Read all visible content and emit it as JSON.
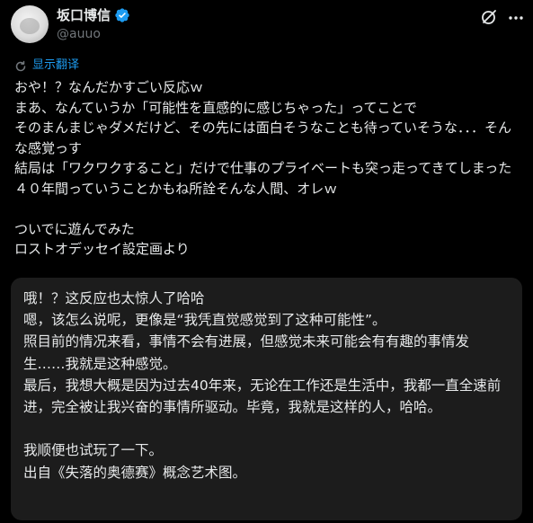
{
  "author": {
    "display_name": "坂口博信",
    "handle": "@auuo",
    "verified": true
  },
  "icons": {
    "avatar": "avatar-image",
    "verified": "verified-badge-icon",
    "grok": "grok-icon",
    "more": "more-icon",
    "translate": "translate-icon"
  },
  "colors": {
    "background": "#000000",
    "text": "#e7e9ea",
    "secondary": "#71767b",
    "link": "#1d9bf0",
    "card": "#1c1c1c"
  },
  "post": {
    "translate_label": "显示翻译",
    "original_text": "おや！？なんだかすごい反応ｗ\nまあ、なんていうか「可能性を直感的に感じちゃった」ってことで\nそのまんまじゃダメだけど、その先には面白そうなことも待っていそうな．．．そんな感覚っす\n結局は「ワクワクすること」だけで仕事のプライベートも突っ走ってきてしまった４０年間っていうことかもね所詮そんな人間、オレｗ\n\nついでに遊んでみた\nロストオデッセイ設定画より",
    "translated_text": "哦！？这反应也太惊人了哈哈\n嗯，该怎么说呢，更像是“我凭直觉感觉到了这种可能性”。\n照目前的情况来看，事情不会有进展，但感觉未来可能会有有趣的事情发生……我就是这种感觉。\n最后，我想大概是因为过去40年来，无论在工作还是生活中，我都一直全速前进，完全被让我兴奋的事情所驱动。毕竟，我就是这样的人，哈哈。\n\n我顺便也试玩了一下。\n出自《失落的奥德赛》概念艺术图。"
  }
}
